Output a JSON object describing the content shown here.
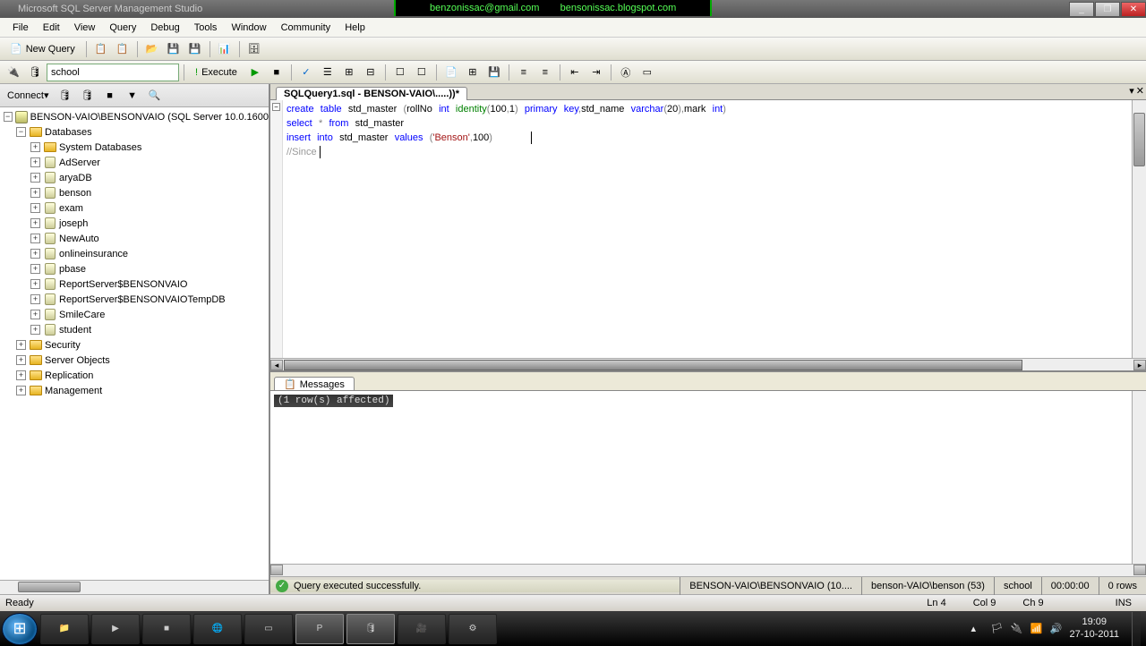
{
  "title_bar": {
    "app_title": "Microsoft SQL Server Management Studio",
    "banner_email": "benzonissac@gmail.com",
    "banner_blog": "bensonissac.blogspot.com"
  },
  "menus": [
    "File",
    "Edit",
    "View",
    "Query",
    "Debug",
    "Tools",
    "Window",
    "Community",
    "Help"
  ],
  "toolbar": {
    "new_query": "New Query"
  },
  "db_dropdown": "school",
  "execute_label": "Execute",
  "object_explorer": {
    "connect": "Connect",
    "server": "BENSON-VAIO\\BENSONVAIO (SQL Server 10.0.1600",
    "databases": "Databases",
    "system_db": "System Databases",
    "dbs": [
      "AdServer",
      "aryaDB",
      "benson",
      "exam",
      "joseph",
      "NewAuto",
      "onlineinsurance",
      "pbase",
      "ReportServer$BENSONVAIO",
      "ReportServer$BENSONVAIOTempDB",
      "SmileCare",
      "student"
    ],
    "folders": [
      "Security",
      "Server Objects",
      "Replication",
      "Management"
    ]
  },
  "editor_tab": "SQLQuery1.sql - BENSON-VAIO\\.....))*",
  "code": {
    "l1a": "create",
    "l1b": "table",
    "l1c": "std_master",
    "l1d": "(",
    "l1e": "rollNo",
    "l1f": "int",
    "l1g": "identity",
    "l1h": "(",
    "l1i": "100",
    "l1j": ",",
    "l1k": "1",
    "l1l": ")",
    "l1m": "primary",
    "l1n": "key",
    "l1o": ",",
    "l1p": "std_name",
    "l1q": "varchar",
    "l1r": "(",
    "l1s": "20",
    "l1t": ")",
    "l1u": ",",
    "l1v": "mark",
    "l1w": "int",
    "l1x": ")",
    "l2a": "select",
    "l2b": "*",
    "l2c": "from",
    "l2d": "std_master",
    "l3a": "insert",
    "l3b": "into",
    "l3c": "std_master",
    "l3d": "values",
    "l3e": "(",
    "l3f": "'Benson'",
    "l3g": ",",
    "l3h": "100",
    "l3i": ")",
    "l4": "//Since "
  },
  "messages_tab": "Messages",
  "messages_text": "(1 row(s) affected)",
  "status_strip": {
    "msg": "Query executed successfully.",
    "server": "BENSON-VAIO\\BENSONVAIO (10....",
    "user": "benson-VAIO\\benson (53)",
    "db": "school",
    "time": "00:00:00",
    "rows": "0 rows"
  },
  "app_status": {
    "ready": "Ready",
    "ln": "Ln 4",
    "col": "Col 9",
    "ch": "Ch 9",
    "ins": "INS"
  },
  "tray": {
    "time": "19:09",
    "date": "27-10-2011"
  }
}
